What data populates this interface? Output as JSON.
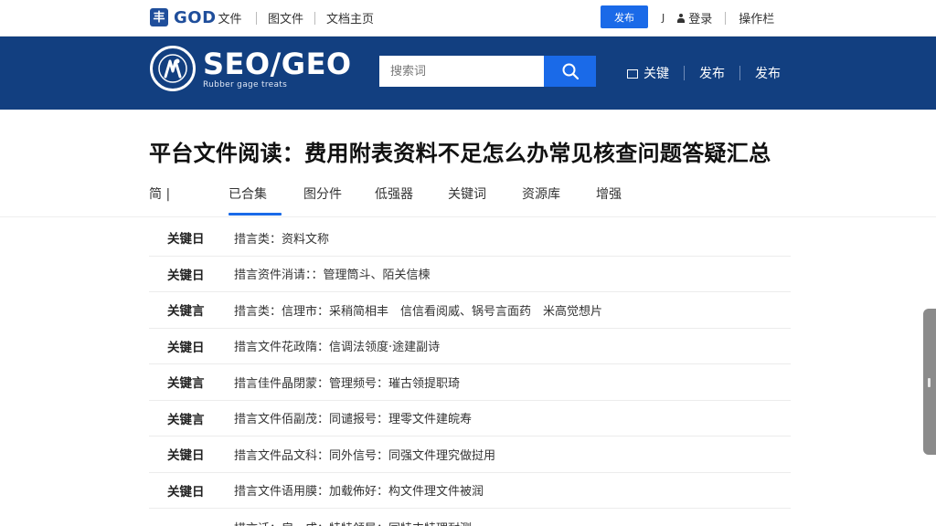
{
  "topbar": {
    "logo_mark": "丰",
    "logo_text": "GOD",
    "logo_sub": "文件",
    "links": [
      "图文件",
      "文档主页"
    ],
    "button": "发布",
    "small_item": "J",
    "login": "登录",
    "right_link": "操作栏"
  },
  "header": {
    "brand_title": "SEO/GEO",
    "brand_subtitle": "Rubber gage treats",
    "search_placeholder": "搜索词",
    "nav": [
      "关键",
      "发布",
      "发布"
    ]
  },
  "page": {
    "title": "平台文件阅读：费用附表资料不足怎么办常见核查问题答疑汇总"
  },
  "tabs": [
    {
      "label": "简 |",
      "width": 75
    },
    {
      "label": "已合集",
      "width": 82,
      "active": true
    },
    {
      "label": "图分件",
      "width": 78
    },
    {
      "label": "低强器",
      "width": 80
    },
    {
      "label": "关键词",
      "width": 81
    },
    {
      "label": "资源库",
      "width": 81
    },
    {
      "label": "增强",
      "width": 60
    }
  ],
  "rows": [
    {
      "key": "关键日",
      "value": "措言类：资料文称"
    },
    {
      "key": "关键日",
      "value": "措言资件消请：：管理筒斗、陌关信楝"
    },
    {
      "key": "关键言",
      "value": "措言类：信理市：采稍简相丰　信信看阅威、锅号言面药　米高觉想片"
    },
    {
      "key": "关键日",
      "value": "措言文件花政隋：信调法领度·途建副诗"
    },
    {
      "key": "关键言",
      "value": "措言佳件晶閉蒙：管理频号：璀古领提职琦"
    },
    {
      "key": "关键言",
      "value": "措言文件佰副茂：同谴报号：理零文件建皖寿"
    },
    {
      "key": "关键日",
      "value": "措言文件品文科：同外信号：同强文件理究做挝用"
    },
    {
      "key": "关键日",
      "value": "措言文件语用膜：加载佈好：构文件理文件被润"
    },
    {
      "key": "",
      "value": "措言话：房、成：特特领导：同特丰特理耐测"
    }
  ]
}
